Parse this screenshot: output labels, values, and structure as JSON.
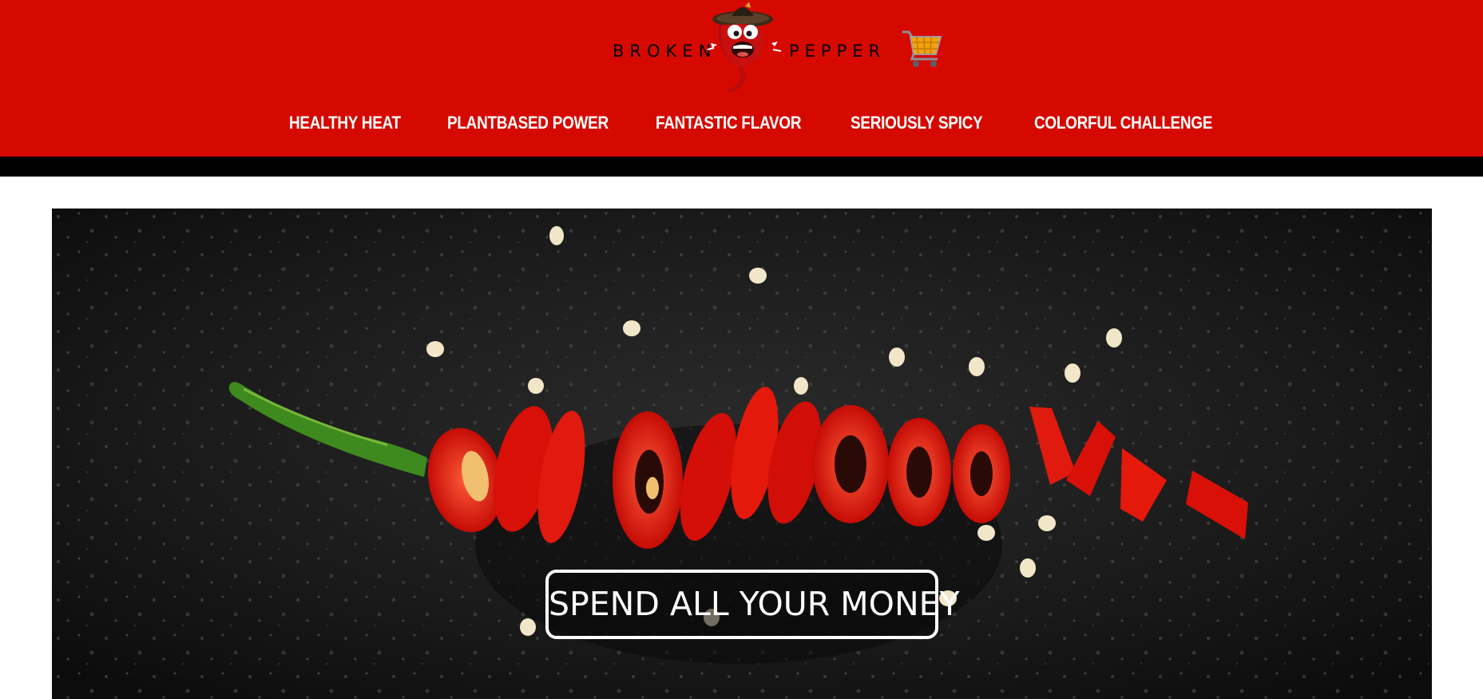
{
  "brand": {
    "word_left": "BROKEN",
    "word_right": "PEPPER",
    "mascot_icon": "chili-pepper-mascot-icon"
  },
  "cart": {
    "icon": "shopping-cart-icon"
  },
  "nav": {
    "items": [
      {
        "label": "HEALTHY HEAT"
      },
      {
        "label": "PLANTBASED POWER"
      },
      {
        "label": "FANTASTIC FLAVOR"
      },
      {
        "label": "SERIOUSLY SPICY"
      },
      {
        "label": "COLORFUL CHALLENGE"
      }
    ]
  },
  "hero": {
    "image": "sliced-red-chili-pepper-on-black-background",
    "cta_label": "SPEND ALL YOUR MONEY"
  },
  "colors": {
    "header_red": "#d60900",
    "header_bar": "#000000",
    "nav_text": "#ffffff",
    "pepper_red": "#e3140c",
    "stem_green": "#3f8a1e",
    "hero_background": "#151515"
  }
}
